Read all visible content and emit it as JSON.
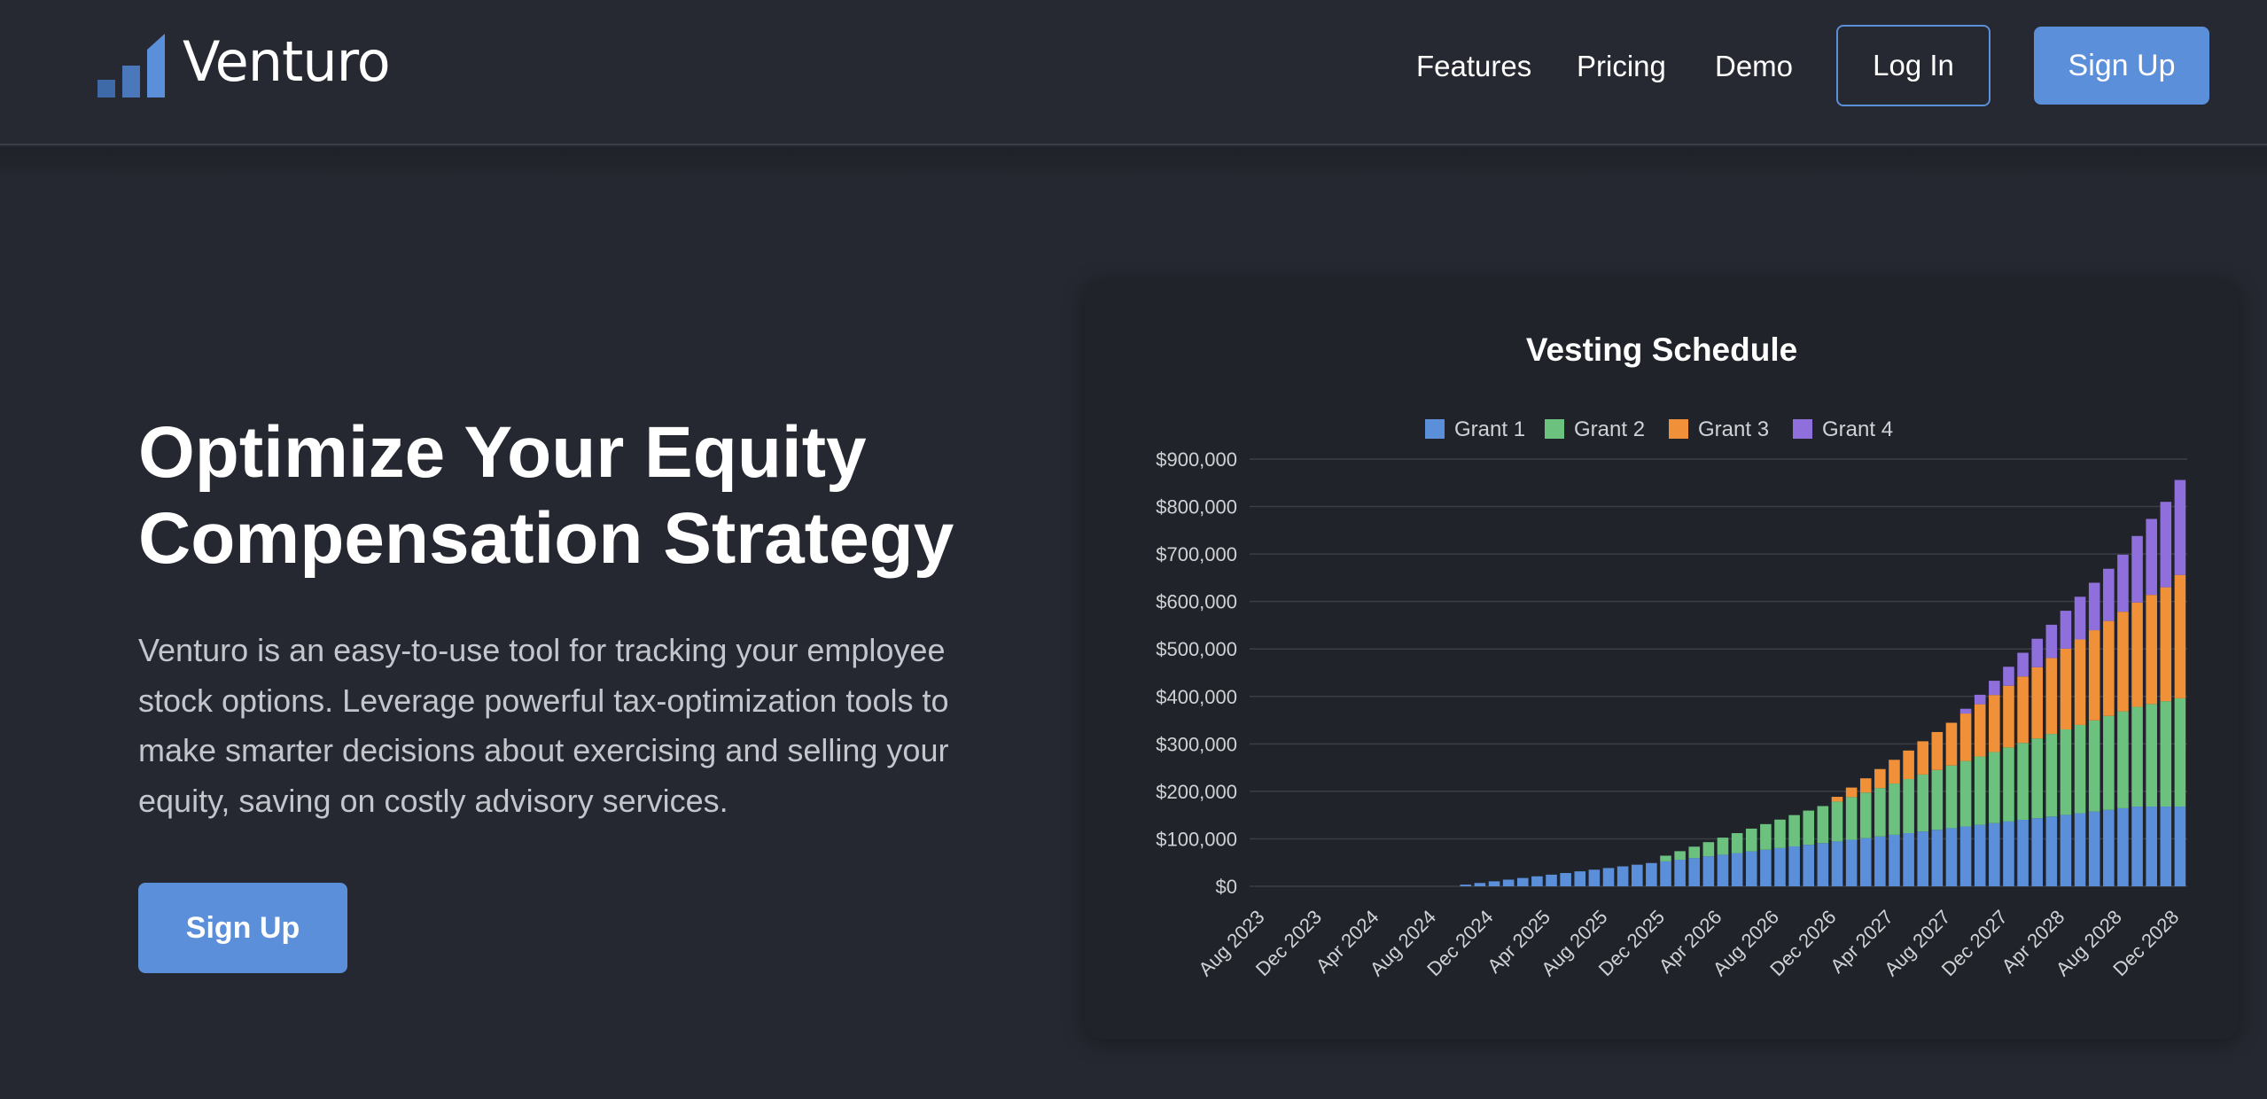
{
  "brand": {
    "name": "Venturo",
    "logo_icon": "bar-chart-logo-icon",
    "accent": "#5b8fd9"
  },
  "nav": {
    "features": "Features",
    "pricing": "Pricing",
    "demo": "Demo",
    "login": "Log In",
    "signup": "Sign Up"
  },
  "hero": {
    "title_line1": "Optimize Your Equity",
    "title_line2": "Compensation Strategy",
    "description": "Venturo is an easy-to-use tool for tracking your employee stock options. Leverage powerful tax-optimization tools to make smarter decisions about exercising and selling your equity, saving on costly advisory services.",
    "cta": "Sign Up"
  },
  "chart_data": {
    "type": "bar",
    "stacked": true,
    "title": "Vesting Schedule",
    "legend_position": "top",
    "grid": true,
    "ylim": [
      0,
      900000
    ],
    "y_ticks": [
      "$0",
      "$100,000",
      "$200,000",
      "$300,000",
      "$400,000",
      "$500,000",
      "$600,000",
      "$700,000",
      "$800,000",
      "$900,000"
    ],
    "x_tick_labels": [
      "Aug 2023",
      "Dec 2023",
      "Apr 2024",
      "Aug 2024",
      "Dec 2024",
      "Apr 2025",
      "Aug 2025",
      "Dec 2025",
      "Apr 2026",
      "Aug 2026",
      "Dec 2026",
      "Apr 2027",
      "Aug 2027",
      "Dec 2027",
      "Apr 2028",
      "Aug 2028",
      "Dec 2028"
    ],
    "categories": [
      "Aug 2023",
      "Sep 2023",
      "Oct 2023",
      "Nov 2023",
      "Dec 2023",
      "Jan 2024",
      "Feb 2024",
      "Mar 2024",
      "Apr 2024",
      "May 2024",
      "Jun 2024",
      "Jul 2024",
      "Aug 2024",
      "Sep 2024",
      "Oct 2024",
      "Nov 2024",
      "Dec 2024",
      "Jan 2025",
      "Feb 2025",
      "Mar 2025",
      "Apr 2025",
      "May 2025",
      "Jun 2025",
      "Jul 2025",
      "Aug 2025",
      "Sep 2025",
      "Oct 2025",
      "Nov 2025",
      "Dec 2025",
      "Jan 2026",
      "Feb 2026",
      "Mar 2026",
      "Apr 2026",
      "May 2026",
      "Jun 2026",
      "Jul 2026",
      "Aug 2026",
      "Sep 2026",
      "Oct 2026",
      "Nov 2026",
      "Dec 2026",
      "Jan 2027",
      "Feb 2027",
      "Mar 2027",
      "Apr 2027",
      "May 2027",
      "Jun 2027",
      "Jul 2027",
      "Aug 2027",
      "Sep 2027",
      "Oct 2027",
      "Nov 2027",
      "Dec 2027",
      "Jan 2028",
      "Feb 2028",
      "Mar 2028",
      "Apr 2028",
      "May 2028",
      "Jun 2028",
      "Jul 2028",
      "Aug 2028",
      "Sep 2028",
      "Oct 2028",
      "Nov 2028",
      "Dec 2028"
    ],
    "series": [
      {
        "name": "Grant 1",
        "color": "#5b8fd9",
        "values": [
          0,
          0,
          0,
          0,
          0,
          0,
          0,
          0,
          0,
          0,
          0,
          0,
          0,
          0,
          3500,
          7000,
          10500,
          14000,
          17500,
          21000,
          24500,
          28000,
          31500,
          35000,
          38500,
          42000,
          45500,
          49000,
          52500,
          56000,
          59500,
          63000,
          66500,
          70000,
          73500,
          77000,
          80500,
          84000,
          87500,
          91000,
          94500,
          98000,
          101500,
          105000,
          108500,
          112000,
          115500,
          119000,
          122500,
          126000,
          129500,
          133000,
          136500,
          140000,
          143500,
          147000,
          150500,
          154000,
          157500,
          161000,
          164500,
          168000,
          168000,
          168000,
          168000
        ]
      },
      {
        "name": "Grant 2",
        "color": "#6cc17f",
        "values": [
          0,
          0,
          0,
          0,
          0,
          0,
          0,
          0,
          0,
          0,
          0,
          0,
          0,
          0,
          0,
          0,
          0,
          0,
          0,
          0,
          0,
          0,
          0,
          0,
          0,
          0,
          0,
          0,
          12000,
          18000,
          24000,
          30000,
          36000,
          42000,
          48000,
          54000,
          60000,
          66000,
          72000,
          78000,
          84000,
          90000,
          96000,
          102000,
          108000,
          114000,
          120000,
          126000,
          132000,
          138000,
          144000,
          150000,
          156000,
          162000,
          168000,
          174000,
          180000,
          186000,
          192000,
          198000,
          204000,
          210000,
          216000,
          222000,
          228000
        ]
      },
      {
        "name": "Grant 3",
        "color": "#f0913a",
        "values": [
          0,
          0,
          0,
          0,
          0,
          0,
          0,
          0,
          0,
          0,
          0,
          0,
          0,
          0,
          0,
          0,
          0,
          0,
          0,
          0,
          0,
          0,
          0,
          0,
          0,
          0,
          0,
          0,
          0,
          0,
          0,
          0,
          0,
          0,
          0,
          0,
          0,
          0,
          0,
          0,
          10000,
          20000,
          30000,
          40000,
          50000,
          60000,
          70000,
          80000,
          90000,
          100000,
          110000,
          120000,
          130000,
          140000,
          150000,
          160000,
          170000,
          180000,
          190000,
          200000,
          210000,
          220000,
          230000,
          240000,
          260000
        ]
      },
      {
        "name": "Grant 4",
        "color": "#8e6fdb",
        "values": [
          0,
          0,
          0,
          0,
          0,
          0,
          0,
          0,
          0,
          0,
          0,
          0,
          0,
          0,
          0,
          0,
          0,
          0,
          0,
          0,
          0,
          0,
          0,
          0,
          0,
          0,
          0,
          0,
          0,
          0,
          0,
          0,
          0,
          0,
          0,
          0,
          0,
          0,
          0,
          0,
          0,
          0,
          0,
          0,
          0,
          0,
          0,
          0,
          0,
          10000,
          20000,
          30000,
          40000,
          50000,
          60000,
          70000,
          80000,
          90000,
          100000,
          110000,
          120000,
          140000,
          160000,
          180000,
          200000
        ]
      }
    ]
  }
}
